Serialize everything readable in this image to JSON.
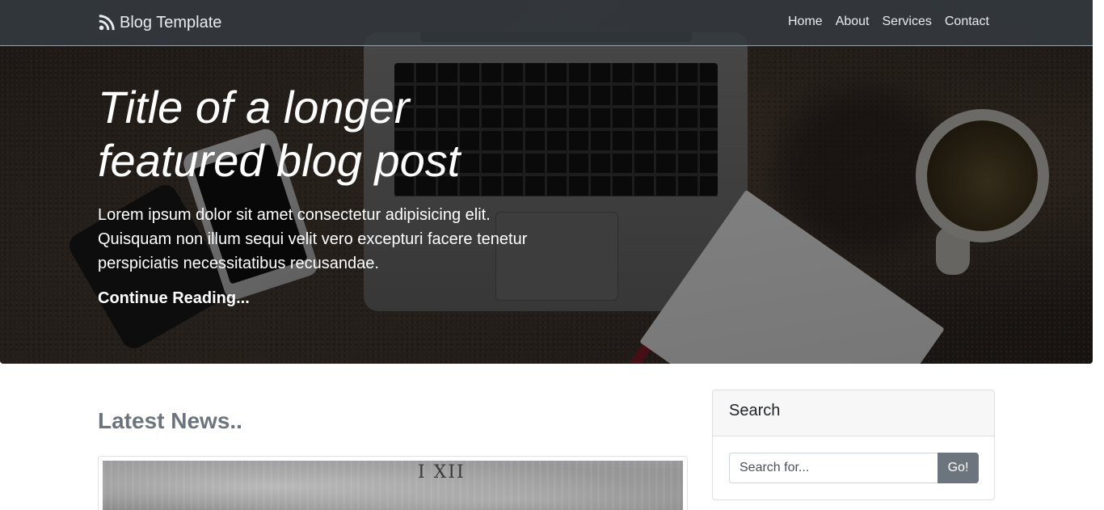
{
  "navbar": {
    "brand": "Blog Template",
    "brand_icon": "rss-feed-icon",
    "links": [
      "Home",
      "About",
      "Services",
      "Contact"
    ],
    "background": "#343a40"
  },
  "hero": {
    "title": "Title of a longer featured blog post",
    "lead": "Lorem ipsum dolor sit amet consectetur adipisicing elit. Quisquam non illum sequi velit vero excepturi facere tenetur perspiciatis necessitatibus recusandae.",
    "cta": "Continue Reading..."
  },
  "main": {
    "section_title": "Latest News..",
    "news_image_text": "I XII"
  },
  "sidebar": {
    "search": {
      "title": "Search",
      "placeholder": "Search for...",
      "button": "Go!",
      "button_color": "#6c757d"
    }
  }
}
